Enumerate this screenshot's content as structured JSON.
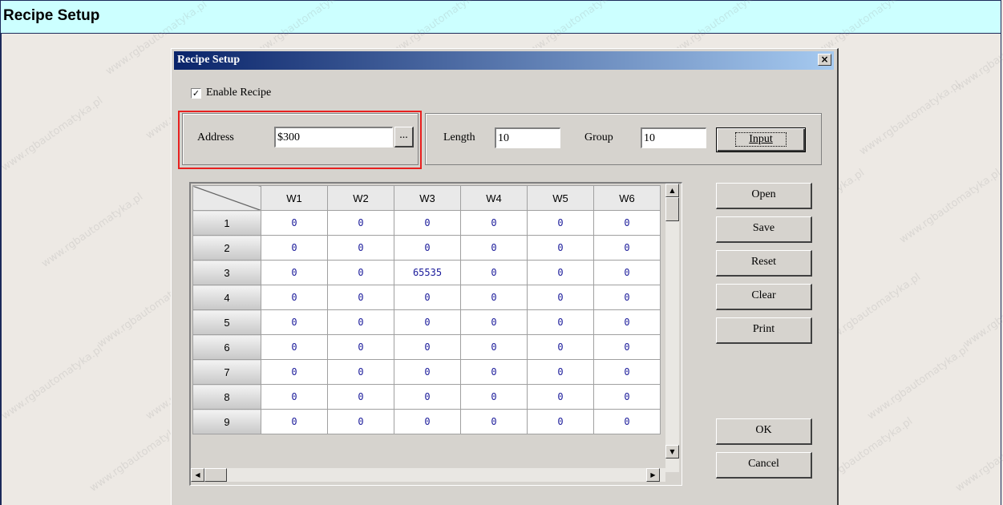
{
  "page": {
    "header_title": "Recipe Setup",
    "watermark": "www.rgbautomatyka.pl"
  },
  "dialog": {
    "title": "Recipe Setup",
    "close_label": "×",
    "enable_recipe": {
      "label": "Enable Recipe",
      "checked": true,
      "check_mark": "✓"
    },
    "address": {
      "label": "Address",
      "value": "$300",
      "browse_label": "..."
    },
    "length": {
      "label": "Length",
      "value": "10"
    },
    "group": {
      "label": "Group",
      "value": "10"
    },
    "input_button": "Input",
    "buttons": {
      "open": "Open",
      "save": "Save",
      "reset": "Reset",
      "clear": "Clear",
      "print": "Print",
      "ok": "OK",
      "cancel": "Cancel"
    },
    "grid": {
      "columns": [
        "W1",
        "W2",
        "W3",
        "W4",
        "W5",
        "W6"
      ],
      "rows": [
        {
          "label": "1",
          "values": [
            "0",
            "0",
            "0",
            "0",
            "0",
            "0"
          ]
        },
        {
          "label": "2",
          "values": [
            "0",
            "0",
            "0",
            "0",
            "0",
            "0"
          ]
        },
        {
          "label": "3",
          "values": [
            "0",
            "0",
            "65535",
            "0",
            "0",
            "0"
          ]
        },
        {
          "label": "4",
          "values": [
            "0",
            "0",
            "0",
            "0",
            "0",
            "0"
          ]
        },
        {
          "label": "5",
          "values": [
            "0",
            "0",
            "0",
            "0",
            "0",
            "0"
          ]
        },
        {
          "label": "6",
          "values": [
            "0",
            "0",
            "0",
            "0",
            "0",
            "0"
          ]
        },
        {
          "label": "7",
          "values": [
            "0",
            "0",
            "0",
            "0",
            "0",
            "0"
          ]
        },
        {
          "label": "8",
          "values": [
            "0",
            "0",
            "0",
            "0",
            "0",
            "0"
          ]
        },
        {
          "label": "9",
          "values": [
            "0",
            "0",
            "0",
            "0",
            "0",
            "0"
          ]
        }
      ]
    }
  },
  "colors": {
    "header_bg": "#ccffff",
    "titlebar_start": "#0a246a",
    "titlebar_end": "#a6caf0",
    "highlight": "#e8201f",
    "cell_text": "#1a1a9a"
  }
}
